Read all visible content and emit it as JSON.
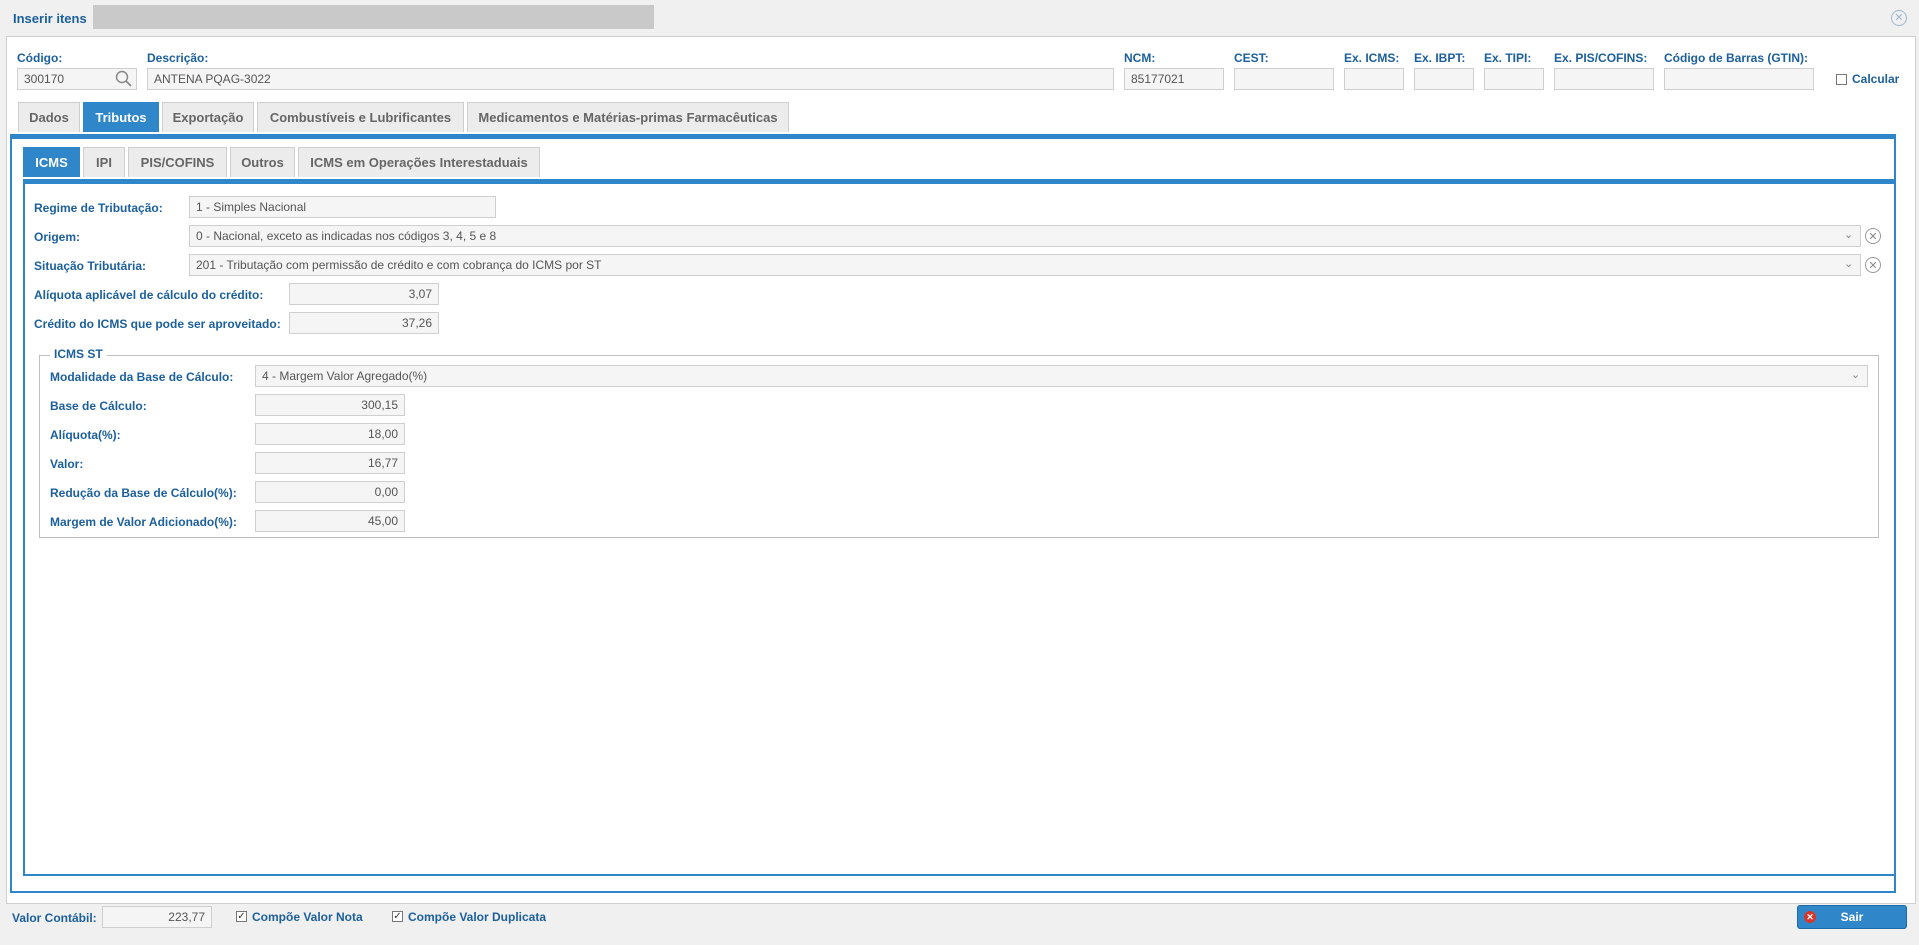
{
  "window": {
    "title": "Inserir itens"
  },
  "header": {
    "codigo_label": "Código:",
    "codigo_value": "300170",
    "descricao_label": "Descrição:",
    "descricao_value": "ANTENA PQAG-3022",
    "ncm_label": "NCM:",
    "ncm_value": "85177021",
    "cest_label": "CEST:",
    "cest_value": "",
    "ex_icms_label": "Ex. ICMS:",
    "ex_icms_value": "",
    "ex_ibpt_label": "Ex. IBPT:",
    "ex_ibpt_value": "",
    "ex_tipi_label": "Ex. TIPI:",
    "ex_tipi_value": "",
    "ex_piscofins_label": "Ex. PIS/COFINS:",
    "ex_piscofins_value": "",
    "gtin_label": "Código de Barras (GTIN):",
    "gtin_value": "",
    "calcular_label": "Calcular",
    "calcular_checked": false
  },
  "tabs": [
    {
      "label": "Dados",
      "active": false
    },
    {
      "label": "Tributos",
      "active": true
    },
    {
      "label": "Exportação",
      "active": false
    },
    {
      "label": "Combustíveis e Lubrificantes",
      "active": false
    },
    {
      "label": "Medicamentos e Matérias-primas Farmacêuticas",
      "active": false
    }
  ],
  "subtabs": [
    {
      "label": "ICMS",
      "active": true
    },
    {
      "label": "IPI",
      "active": false
    },
    {
      "label": "PIS/COFINS",
      "active": false
    },
    {
      "label": "Outros",
      "active": false
    },
    {
      "label": "ICMS em Operações Interestaduais",
      "active": false
    }
  ],
  "icms": {
    "regime_label": "Regime de Tributação:",
    "regime_value": "1 - Simples Nacional",
    "origem_label": "Origem:",
    "origem_value": "0 - Nacional, exceto as indicadas nos códigos 3, 4, 5 e 8",
    "situacao_label": "Situação Tributária:",
    "situacao_value": "201 - Tributação com permissão de crédito e com cobrança do ICMS por ST",
    "aliquota_credito_label": "Alíquota aplicável de cálculo do crédito:",
    "aliquota_credito_value": "3,07",
    "credito_label": "Crédito do ICMS que pode ser aproveitado:",
    "credito_value": "37,26"
  },
  "icms_st": {
    "legend": "ICMS ST",
    "modalidade_label": "Modalidade da Base de Cálculo:",
    "modalidade_value": "4 - Margem Valor Agregado(%)",
    "base_label": "Base de Cálculo:",
    "base_value": "300,15",
    "aliquota_label": "Alíquota(%):",
    "aliquota_value": "18,00",
    "valor_label": "Valor:",
    "valor_value": "16,77",
    "reducao_label": "Redução da Base de Cálculo(%):",
    "reducao_value": "0,00",
    "margem_label": "Margem de Valor Adicionado(%):",
    "margem_value": "45,00"
  },
  "footer": {
    "valor_contabil_label": "Valor Contábil:",
    "valor_contabil_value": "223,77",
    "compoe_nota_label": "Compõe Valor Nota",
    "compoe_nota_checked": true,
    "compoe_duplicata_label": "Compõe Valor Duplicata",
    "compoe_duplicata_checked": true,
    "sair_label": "Sair"
  },
  "icons": {
    "search": "search-icon",
    "close": "close-icon",
    "chevron": "chevron-down-icon",
    "clear": "clear-icon",
    "exit": "exit-icon"
  },
  "colors": {
    "accent": "#2f86c8",
    "label": "#1b5f9c",
    "exit": "#d9342b"
  }
}
